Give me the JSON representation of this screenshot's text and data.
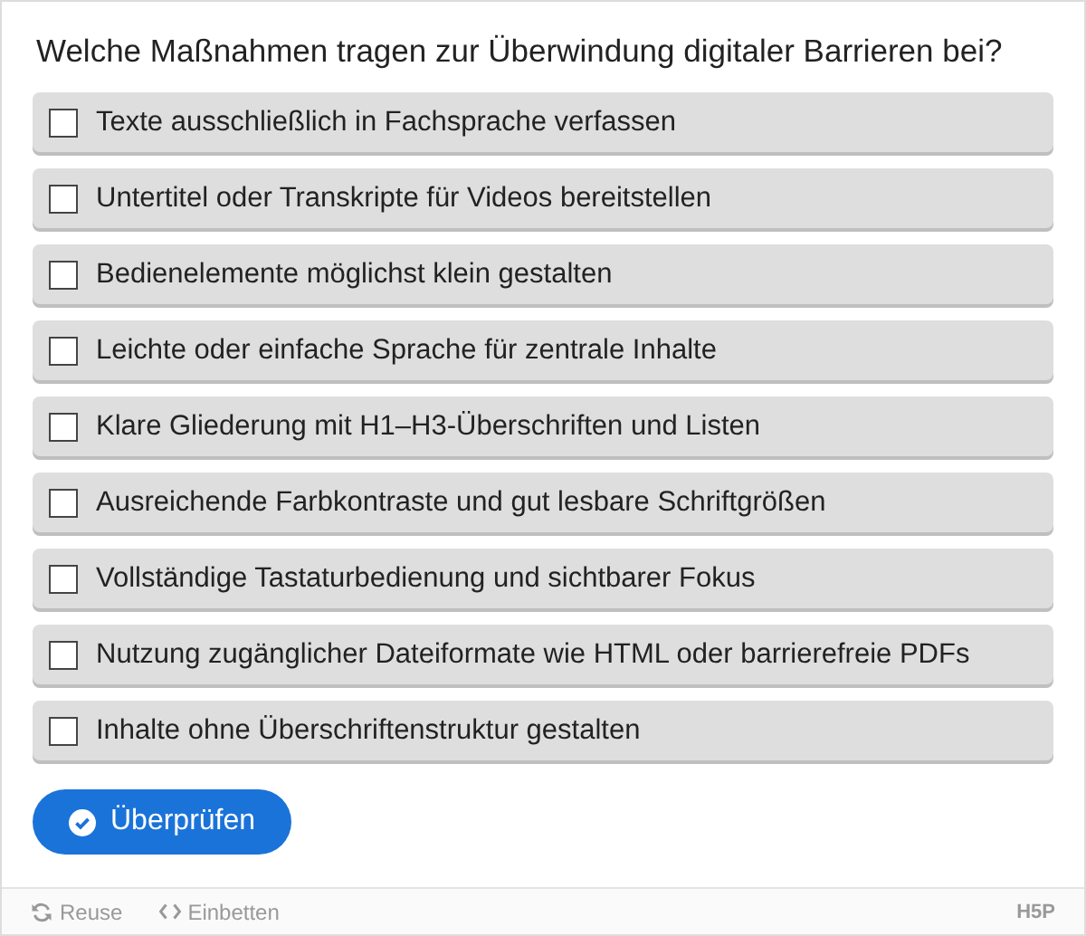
{
  "question": "Welche Maßnahmen tragen zur Überwindung digitaler Barrieren bei?",
  "options": [
    {
      "label": "Texte ausschließlich in Fachsprache verfassen",
      "checked": false
    },
    {
      "label": "Untertitel oder Transkripte für Videos bereitstellen",
      "checked": false
    },
    {
      "label": "Bedienelemente möglichst klein gestalten",
      "checked": false
    },
    {
      "label": "Leichte oder einfache Sprache für zentrale Inhalte",
      "checked": false
    },
    {
      "label": "Klare Gliederung mit H1–H3-Überschriften und Listen",
      "checked": false
    },
    {
      "label": "Ausreichende Farbkontraste und gut lesbare Schriftgrößen",
      "checked": false
    },
    {
      "label": "Vollständige Tastaturbedienung und sichtbarer Fokus",
      "checked": false
    },
    {
      "label": "Nutzung zugänglicher Dateiformate wie HTML oder barrierefreie PDFs",
      "checked": false
    },
    {
      "label": "Inhalte ohne Überschriftenstruktur gestalten",
      "checked": false
    }
  ],
  "check_button": "Überprüfen",
  "footer": {
    "links": [
      {
        "kind": "reuse",
        "label": "Reuse"
      },
      {
        "kind": "embed",
        "label": "Einbetten"
      }
    ],
    "logo": "H5P"
  }
}
